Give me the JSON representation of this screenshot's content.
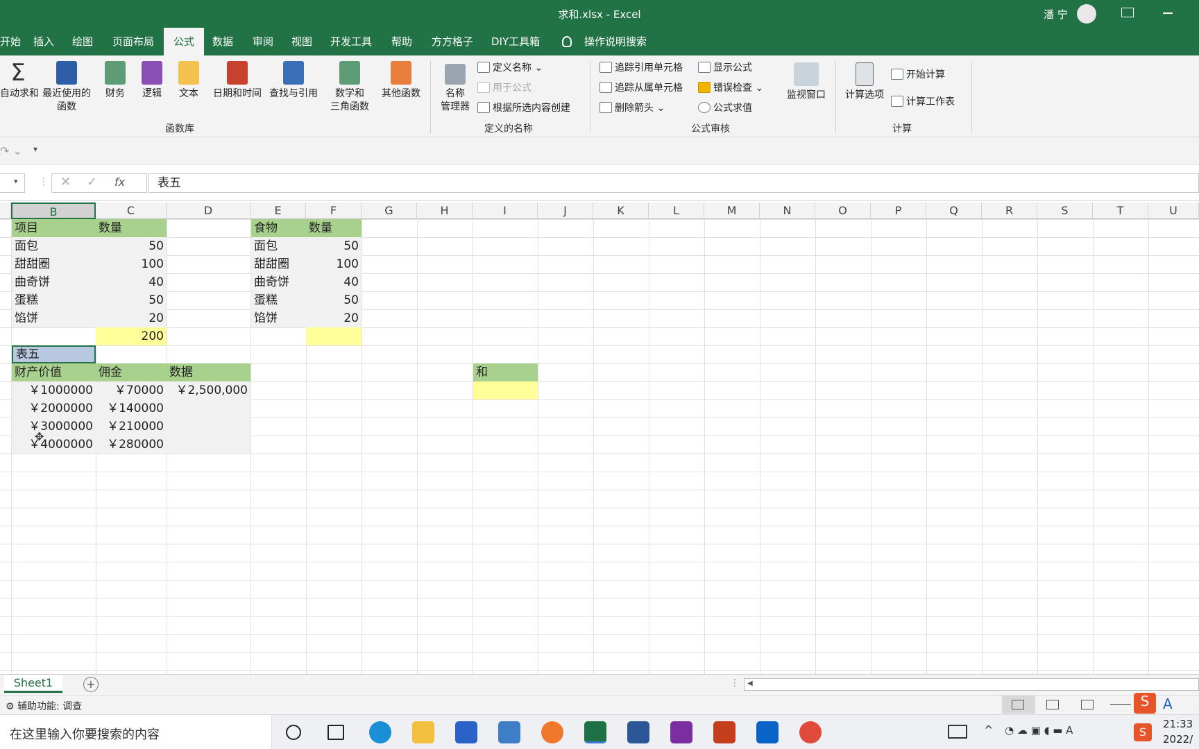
{
  "window": {
    "title": "求和.xlsx  -  Excel",
    "user": "潘 宁"
  },
  "tabs": [
    "开始",
    "插入",
    "绘图",
    "页面布局",
    "公式",
    "数据",
    "审阅",
    "视图",
    "开发工具",
    "帮助",
    "方方格子",
    "DIY工具箱"
  ],
  "tell_me": "操作说明搜索",
  "ribbon": {
    "autosum": "自动求和",
    "recent": "最近使用的",
    "recent2": "函数",
    "finance": "财务",
    "logic": "逻辑",
    "text": "文本",
    "datetime": "日期和时间",
    "lookup": "查找与引用",
    "math": "数学和",
    "math2": "三角函数",
    "other": "其他函数",
    "group_lib": "函数库",
    "name_mgr": "名称",
    "name_mgr2": "管理器",
    "define_name": "定义名称",
    "use_in_formula": "用于公式",
    "create_from_sel": "根据所选内容创建",
    "group_names": "定义的名称",
    "trace_prec": "追踪引用单元格",
    "trace_dep": "追踪从属单元格",
    "remove_arrows": "删除箭头",
    "show_formulas": "显示公式",
    "error_check": "错误检查",
    "eval_formula": "公式求值",
    "group_audit": "公式审核",
    "watch": "监视窗口",
    "calc_options": "计算选项",
    "calc_now": "开始计算",
    "calc_sheet": "计算工作表",
    "group_calc": "计算"
  },
  "formula": {
    "value": "表五",
    "fx": "fx"
  },
  "columns": [
    "B",
    "C",
    "D",
    "E",
    "F",
    "G",
    "H",
    "I",
    "J",
    "K",
    "L",
    "M",
    "N",
    "O",
    "P",
    "Q",
    "R",
    "S",
    "T",
    "U"
  ],
  "table1": {
    "h1": "项目",
    "h2": "数量",
    "rows": [
      [
        "面包",
        "50"
      ],
      [
        "甜甜圈",
        "100"
      ],
      [
        "曲奇饼",
        "40"
      ],
      [
        "蛋糕",
        "50"
      ],
      [
        "馅饼",
        "20"
      ]
    ],
    "total": "200"
  },
  "table2": {
    "h1": "食物",
    "h2": "数量",
    "rows": [
      [
        "面包",
        "50"
      ],
      [
        "甜甜圈",
        "100"
      ],
      [
        "曲奇饼",
        "40"
      ],
      [
        "蛋糕",
        "50"
      ],
      [
        "馅饼",
        "20"
      ]
    ]
  },
  "table5": {
    "title": "表五",
    "h1": "财产价值",
    "h2": "佣金",
    "h3": "数据",
    "d1": "￥2,500,000",
    "rows": [
      [
        "￥1000000",
        "￥70000"
      ],
      [
        "￥2000000",
        "￥140000"
      ],
      [
        "￥3000000",
        "￥210000"
      ],
      [
        "￥4000000",
        "￥280000"
      ]
    ]
  },
  "sum": {
    "label": "和"
  },
  "sheet": {
    "name": "Sheet1"
  },
  "status": {
    "accessibility": "辅助功能: 调查"
  },
  "taskbar": {
    "search": "在这里输入你要搜索的内容",
    "time": "21:33",
    "date": "2022/"
  }
}
